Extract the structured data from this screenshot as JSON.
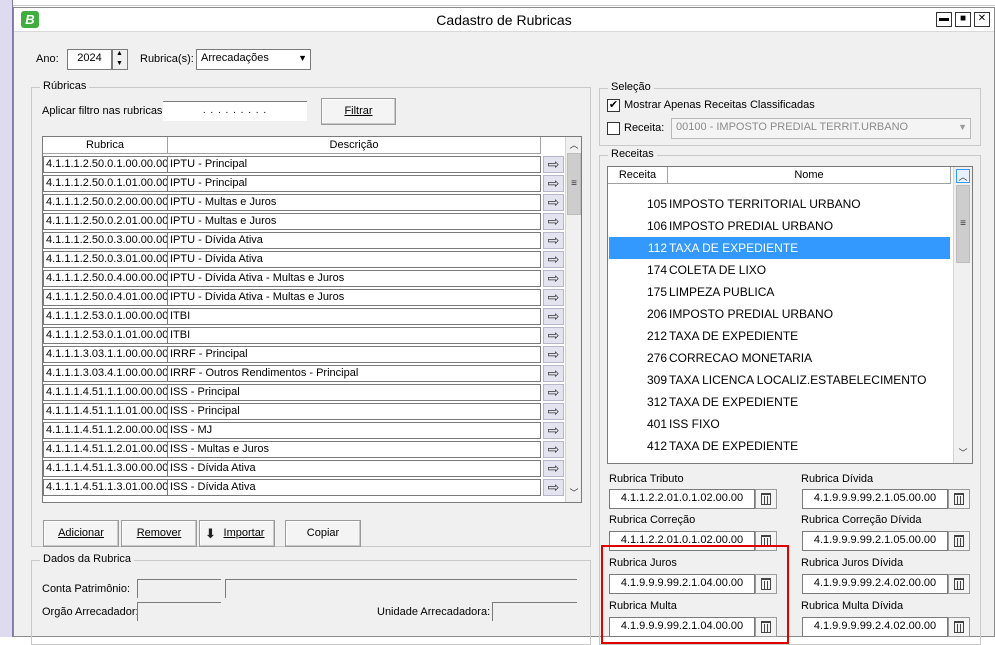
{
  "window": {
    "title": "Cadastro de Rubricas",
    "logo_letter": "B",
    "controls": [
      "▬",
      "■",
      "✕"
    ]
  },
  "top": {
    "ano_label": "Ano:",
    "ano_value": "2024",
    "rubricas_label": "Rubrica(s):",
    "rubricas_value": "Arrecadações"
  },
  "rubricas_group": {
    "title": "Rúbricas",
    "filter_label": "Aplicar filtro nas rubricas",
    "filter_mask": ". . . . . . . . .",
    "filter_button": "Filtrar",
    "columns": [
      "Rubrica",
      "Descrição"
    ],
    "rows": [
      {
        "rubrica": "4.1.1.1.2.50.0.1.00.00.00",
        "descricao": "IPTU - Principal"
      },
      {
        "rubrica": "4.1.1.1.2.50.0.1.01.00.00",
        "descricao": "IPTU - Principal"
      },
      {
        "rubrica": "4.1.1.1.2.50.0.2.00.00.00",
        "descricao": "IPTU - Multas e Juros"
      },
      {
        "rubrica": "4.1.1.1.2.50.0.2.01.00.00",
        "descricao": "IPTU - Multas e Juros"
      },
      {
        "rubrica": "4.1.1.1.2.50.0.3.00.00.00",
        "descricao": "IPTU - Dívida Ativa"
      },
      {
        "rubrica": "4.1.1.1.2.50.0.3.01.00.00",
        "descricao": "IPTU - Dívida Ativa"
      },
      {
        "rubrica": "4.1.1.1.2.50.0.4.00.00.00",
        "descricao": "IPTU - Dívida Ativa - Multas e Juros"
      },
      {
        "rubrica": "4.1.1.1.2.50.0.4.01.00.00",
        "descricao": "IPTU - Dívida Ativa - Multas e Juros"
      },
      {
        "rubrica": "4.1.1.1.2.53.0.1.00.00.00",
        "descricao": "ITBI"
      },
      {
        "rubrica": "4.1.1.1.2.53.0.1.01.00.00",
        "descricao": "ITBI"
      },
      {
        "rubrica": "4.1.1.1.3.03.1.1.00.00.00",
        "descricao": "IRRF - Principal"
      },
      {
        "rubrica": "4.1.1.1.3.03.4.1.00.00.00",
        "descricao": "IRRF - Outros Rendimentos - Principal"
      },
      {
        "rubrica": "4.1.1.1.4.51.1.1.00.00.00",
        "descricao": "ISS - Principal"
      },
      {
        "rubrica": "4.1.1.1.4.51.1.1.01.00.00",
        "descricao": "ISS - Principal"
      },
      {
        "rubrica": "4.1.1.1.4.51.1.2.00.00.00",
        "descricao": "ISS - MJ"
      },
      {
        "rubrica": "4.1.1.1.4.51.1.2.01.00.00",
        "descricao": "ISS - Multas e Juros"
      },
      {
        "rubrica": "4.1.1.1.4.51.1.3.00.00.00",
        "descricao": "ISS - Dívida Ativa"
      },
      {
        "rubrica": "4.1.1.1.4.51.1.3.01.00.00",
        "descricao": "ISS - Dívida Ativa"
      }
    ],
    "buttons": {
      "adicionar": "Adicionar",
      "remover": "Remover",
      "importar": "Importar",
      "copiar": "Copiar"
    }
  },
  "dados_group": {
    "title": "Dados da Rubrica",
    "conta_label": "Conta Patrimônio:",
    "orgao_label": "Orgão Arrecadador:",
    "unidade_label": "Unidade Arrecadadora:"
  },
  "selecao_group": {
    "title": "Seleção",
    "mostrar_label": "Mostrar Apenas Receitas Classificadas",
    "mostrar_checked": true,
    "receita_label": "Receita:",
    "receita_checked": false,
    "receita_value": "00100 - IMPOSTO PREDIAL TERRIT.URBANO"
  },
  "receitas_group": {
    "title": "Receitas",
    "columns": [
      "Receita",
      "Nome"
    ],
    "rows": [
      {
        "codigo": "105",
        "nome": "IMPOSTO TERRITORIAL URBANO",
        "selected": false
      },
      {
        "codigo": "106",
        "nome": "IMPOSTO PREDIAL URBANO",
        "selected": false
      },
      {
        "codigo": "112",
        "nome": "TAXA DE EXPEDIENTE",
        "selected": true
      },
      {
        "codigo": "174",
        "nome": "COLETA DE LIXO",
        "selected": false
      },
      {
        "codigo": "175",
        "nome": "LIMPEZA PUBLICA",
        "selected": false
      },
      {
        "codigo": "206",
        "nome": "IMPOSTO PREDIAL URBANO",
        "selected": false
      },
      {
        "codigo": "212",
        "nome": "TAXA DE EXPEDIENTE",
        "selected": false
      },
      {
        "codigo": "276",
        "nome": "CORRECAO MONETARIA",
        "selected": false
      },
      {
        "codigo": "309",
        "nome": "TAXA LICENCA LOCALIZ.ESTABELECIMENTO",
        "selected": false
      },
      {
        "codigo": "312",
        "nome": "TAXA DE EXPEDIENTE",
        "selected": false
      },
      {
        "codigo": "401",
        "nome": "ISS FIXO",
        "selected": false
      },
      {
        "codigo": "412",
        "nome": "TAXA DE EXPEDIENTE",
        "selected": false
      }
    ]
  },
  "rubrica_fields": {
    "tributo_label": "Rubrica Tributo",
    "tributo_value": "4.1.1.2.2.01.0.1.02.00.00",
    "divida_label": "Rubrica Dívida",
    "divida_value": "4.1.9.9.9.99.2.1.05.00.00",
    "correcao_label": "Rubrica Correção",
    "correcao_value": "4.1.1.2.2.01.0.1.02.00.00",
    "correcao_divida_label": "Rubrica Correção Dívida",
    "correcao_divida_value": "4.1.9.9.9.99.2.1.05.00.00",
    "juros_label": "Rubrica Juros",
    "juros_value": "4.1.9.9.9.99.2.1.04.00.00",
    "juros_divida_label": "Rubrica Juros Dívida",
    "juros_divida_value": "4.1.9.9.9.99.2.4.02.00.00",
    "multa_label": "Rubrica Multa",
    "multa_value": "4.1.9.9.9.99.2.1.04.00.00",
    "multa_divida_label": "Rubrica Multa Dívida",
    "multa_divida_value": "4.1.9.9.9.99.2.4.02.00.00"
  },
  "colors": {
    "selection": "#3399ff",
    "highlight_border": "#e00000",
    "logo": "#3fae3f"
  },
  "icons": [
    "app-logo-icon",
    "minimize-icon",
    "maximize-icon",
    "close-icon",
    "spin-up-icon",
    "spin-down-icon",
    "dropdown-arrow-icon",
    "row-action-arrow-icon",
    "scroll-up-icon",
    "scroll-down-icon",
    "import-icon",
    "trash-icon",
    "checkmark-icon"
  ]
}
